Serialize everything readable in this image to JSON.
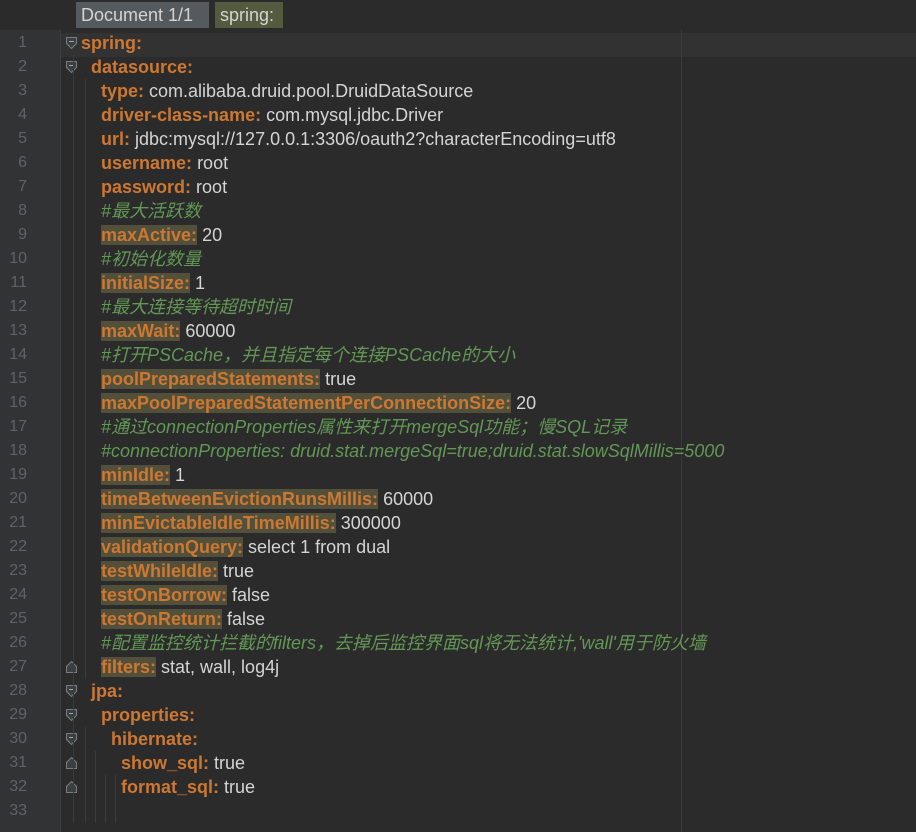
{
  "breadcrumb": {
    "document": "Document 1/1",
    "path": "spring:"
  },
  "colors": {
    "background": "#2b2b2b",
    "gutter": "#313335",
    "key": "#cc7832",
    "value": "#d4d4d4",
    "comment": "#629755",
    "highlight": "#52503a",
    "line_number": "#606366"
  },
  "lines": [
    {
      "n": "1",
      "indent": 0,
      "key": "spring:",
      "value": "",
      "comment": "",
      "hl": false,
      "fold": "open"
    },
    {
      "n": "2",
      "indent": 1,
      "key": "datasource:",
      "value": "",
      "comment": "",
      "hl": false,
      "fold": "open"
    },
    {
      "n": "3",
      "indent": 2,
      "key": "type:",
      "value": "com.alibaba.druid.pool.DruidDataSource",
      "comment": "",
      "hl": false,
      "fold": ""
    },
    {
      "n": "4",
      "indent": 2,
      "key": "driver-class-name:",
      "value": "com.mysql.jdbc.Driver",
      "comment": "",
      "hl": false,
      "fold": ""
    },
    {
      "n": "5",
      "indent": 2,
      "key": "url:",
      "value": "jdbc:mysql://127.0.0.1:3306/oauth2?characterEncoding=utf8",
      "comment": "",
      "hl": false,
      "fold": ""
    },
    {
      "n": "6",
      "indent": 2,
      "key": "username:",
      "value": "root",
      "comment": "",
      "hl": false,
      "fold": ""
    },
    {
      "n": "7",
      "indent": 2,
      "key": "password:",
      "value": "root",
      "comment": "",
      "hl": false,
      "fold": ""
    },
    {
      "n": "8",
      "indent": 2,
      "key": "",
      "value": "",
      "comment": "#最大活跃数",
      "hl": false,
      "fold": ""
    },
    {
      "n": "9",
      "indent": 2,
      "key": "maxActive:",
      "value": "20",
      "comment": "",
      "hl": true,
      "fold": ""
    },
    {
      "n": "10",
      "indent": 2,
      "key": "",
      "value": "",
      "comment": "#初始化数量",
      "hl": false,
      "fold": ""
    },
    {
      "n": "11",
      "indent": 2,
      "key": "initialSize:",
      "value": "1",
      "comment": "",
      "hl": true,
      "fold": ""
    },
    {
      "n": "12",
      "indent": 2,
      "key": "",
      "value": "",
      "comment": "#最大连接等待超时时间",
      "hl": false,
      "fold": ""
    },
    {
      "n": "13",
      "indent": 2,
      "key": "maxWait:",
      "value": "60000",
      "comment": "",
      "hl": true,
      "fold": ""
    },
    {
      "n": "14",
      "indent": 2,
      "key": "",
      "value": "",
      "comment": "#打开PSCache，并且指定每个连接PSCache的大小",
      "hl": false,
      "fold": ""
    },
    {
      "n": "15",
      "indent": 2,
      "key": "poolPreparedStatements:",
      "value": "true",
      "comment": "",
      "hl": true,
      "fold": ""
    },
    {
      "n": "16",
      "indent": 2,
      "key": "maxPoolPreparedStatementPerConnectionSize:",
      "value": "20",
      "comment": "",
      "hl": true,
      "fold": ""
    },
    {
      "n": "17",
      "indent": 2,
      "key": "",
      "value": "",
      "comment": "#通过connectionProperties属性来打开mergeSql功能；慢SQL记录",
      "hl": false,
      "fold": ""
    },
    {
      "n": "18",
      "indent": 2,
      "key": "",
      "value": "",
      "comment": "#connectionProperties: druid.stat.mergeSql=true;druid.stat.slowSqlMillis=5000",
      "hl": false,
      "fold": ""
    },
    {
      "n": "19",
      "indent": 2,
      "key": "minIdle:",
      "value": "1",
      "comment": "",
      "hl": true,
      "fold": ""
    },
    {
      "n": "20",
      "indent": 2,
      "key": "timeBetweenEvictionRunsMillis:",
      "value": "60000",
      "comment": "",
      "hl": true,
      "fold": ""
    },
    {
      "n": "21",
      "indent": 2,
      "key": "minEvictableIdleTimeMillis:",
      "value": "300000",
      "comment": "",
      "hl": true,
      "fold": ""
    },
    {
      "n": "22",
      "indent": 2,
      "key": "validationQuery:",
      "value": "select 1 from dual",
      "comment": "",
      "hl": true,
      "fold": ""
    },
    {
      "n": "23",
      "indent": 2,
      "key": "testWhileIdle:",
      "value": "true",
      "comment": "",
      "hl": true,
      "fold": ""
    },
    {
      "n": "24",
      "indent": 2,
      "key": "testOnBorrow:",
      "value": "false",
      "comment": "",
      "hl": true,
      "fold": ""
    },
    {
      "n": "25",
      "indent": 2,
      "key": "testOnReturn:",
      "value": "false",
      "comment": "",
      "hl": true,
      "fold": ""
    },
    {
      "n": "26",
      "indent": 2,
      "key": "",
      "value": "",
      "comment": "#配置监控统计拦截的filters，去掉后监控界面sql将无法统计,'wall'用于防火墙",
      "hl": false,
      "fold": ""
    },
    {
      "n": "27",
      "indent": 2,
      "key": "filters:",
      "value": "stat, wall, log4j",
      "comment": "",
      "hl": true,
      "fold": "end"
    },
    {
      "n": "28",
      "indent": 1,
      "key": "jpa:",
      "value": "",
      "comment": "",
      "hl": false,
      "fold": "open"
    },
    {
      "n": "29",
      "indent": 2,
      "key": "properties:",
      "value": "",
      "comment": "",
      "hl": false,
      "fold": "open"
    },
    {
      "n": "30",
      "indent": 3,
      "key": "hibernate:",
      "value": "",
      "comment": "",
      "hl": false,
      "fold": "open"
    },
    {
      "n": "31",
      "indent": 4,
      "key": "show_sql:",
      "value": "true",
      "comment": "",
      "hl": false,
      "fold": "end"
    },
    {
      "n": "32",
      "indent": 4,
      "key": "format_sql:",
      "value": "true",
      "comment": "",
      "hl": false,
      "fold": "end"
    },
    {
      "n": "33",
      "indent": 0,
      "key": "",
      "value": "",
      "comment": "",
      "hl": false,
      "fold": ""
    }
  ]
}
